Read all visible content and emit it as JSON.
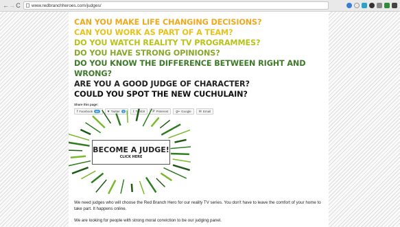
{
  "browser": {
    "back": "←",
    "forward": "→",
    "reload": "C",
    "url": "www.redbranchheroes.com/judges/"
  },
  "headlines": [
    {
      "text": "CAN YOU MAKE LIFE CHANGING DECISIONS?",
      "color": "#f0a81e"
    },
    {
      "text": "CAN YOU WORK AS PART OF A TEAM?",
      "color": "#e6c31a"
    },
    {
      "text": "DO YOU WATCH REALITY TV PROGRAMMES?",
      "color": "#b7c21b"
    },
    {
      "text": "DO YOU HAVE STRONG OPINIONS?",
      "color": "#87a82a"
    },
    {
      "text": "DO YOU KNOW THE DIFFERENCE BETWEEN RIGHT AND",
      "color": "#3f7a2a"
    },
    {
      "text": "WRONG?",
      "color": "#3f7a2a"
    },
    {
      "text": "ARE YOU A GOOD JUDGE OF CHARACTER?",
      "color": "#222222"
    },
    {
      "text": "COULD YOU SPOT THE NEW CUCHULAIN?",
      "color": "#111111"
    }
  ],
  "share": {
    "label": "Share this page:",
    "buttons": [
      {
        "icon": "f",
        "icon_name": "facebook-icon",
        "label": "Facebook",
        "count": "48"
      },
      {
        "icon": "♥",
        "icon_name": "twitter-icon",
        "label": "Twitter",
        "count": "3"
      },
      {
        "icon": "t",
        "icon_name": "tumblr-icon",
        "label": "Tumblr"
      },
      {
        "icon": "P",
        "icon_name": "pinterest-icon",
        "label": "Pinterest"
      },
      {
        "icon": "g+",
        "icon_name": "google-plus-icon",
        "label": "Google"
      },
      {
        "icon": "✉",
        "icon_name": "email-icon",
        "label": "Email"
      }
    ]
  },
  "banner": {
    "title": "BECOME A JUDGE!",
    "subtitle": "CLICK HERE",
    "ray_colors": [
      "#2e7d1f",
      "#7ab929",
      "#1c5a14"
    ]
  },
  "body_text": {
    "para1": "We need judges who will choose the Red Branch Hero for our reality TV series. You don't have to leave the comfort of your home to take part. It happens online.",
    "para2": "We are looking for people with strong moral conviction to be our judging panel."
  }
}
